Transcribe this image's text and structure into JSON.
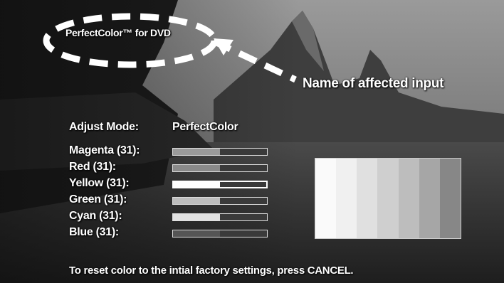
{
  "header": {
    "input_name": "PerfectColor™ for DVD"
  },
  "annotation": {
    "callout_text": "Name of affected input"
  },
  "adjust": {
    "label": "Adjust Mode:",
    "value": "PerfectColor"
  },
  "sliders": [
    {
      "label": "Magenta (31):",
      "level": 0.5,
      "fill_color": "#9a9a9a",
      "selected": false
    },
    {
      "label": "Red (31):",
      "level": 0.5,
      "fill_color": "#8a8a8a",
      "selected": false
    },
    {
      "label": "Yellow (31):",
      "level": 0.5,
      "fill_color": "#ffffff",
      "selected": true
    },
    {
      "label": "Green (31):",
      "level": 0.5,
      "fill_color": "#bdbdbd",
      "selected": false
    },
    {
      "label": "Cyan (31):",
      "level": 0.5,
      "fill_color": "#e2e2e2",
      "selected": false
    },
    {
      "label": "Blue (31):",
      "level": 0.5,
      "fill_color": "#555555",
      "selected": false
    }
  ],
  "preview": {
    "swatch_colors": [
      "#fafafa",
      "#f0f0f0",
      "#e0e0e0",
      "#cfcfcf",
      "#bdbdbd",
      "#a6a6a6",
      "#878787"
    ]
  },
  "footer": {
    "hint": "To reset color to the intial factory settings, press CANCEL."
  }
}
